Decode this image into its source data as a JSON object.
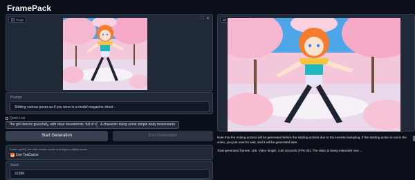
{
  "app": {
    "title": "FramePack"
  },
  "left": {
    "image_tag": "Image",
    "prompt_label": "Prompt",
    "prompt_value": "Striking various poses as if you were in a model magazine shoot",
    "quick_list_label": "Quick List",
    "quick_list": [
      "The girl dances gracefully, with clear movements, full of charm.",
      "A character doing some simple body movements."
    ],
    "start_label": "Start Generation",
    "end_label": "End Generation",
    "teacache_info": "Faster speed, but often makes hands and fingers slightly worse.",
    "teacache_label": "Use TeaCache",
    "seed_label": "Seed",
    "seed_value": "31388"
  },
  "right": {
    "video_tag": "Finished Frames",
    "note": "Note that the ending actions will be generated before the starting actions due to the inverted sampling. If the starting action is not in the video, you just need to wait, and it will be generated later.",
    "status": "Total generated frames: 105, Video length: 3.50 seconds (FPS-30). The video is being extended now ..."
  },
  "colors": {
    "accent": "#f97316",
    "background": "#0b0f19",
    "panel": "#1f2937"
  },
  "icons": [
    "image-icon",
    "video-icon",
    "download-icon",
    "fullscreen-icon",
    "close-icon"
  ]
}
